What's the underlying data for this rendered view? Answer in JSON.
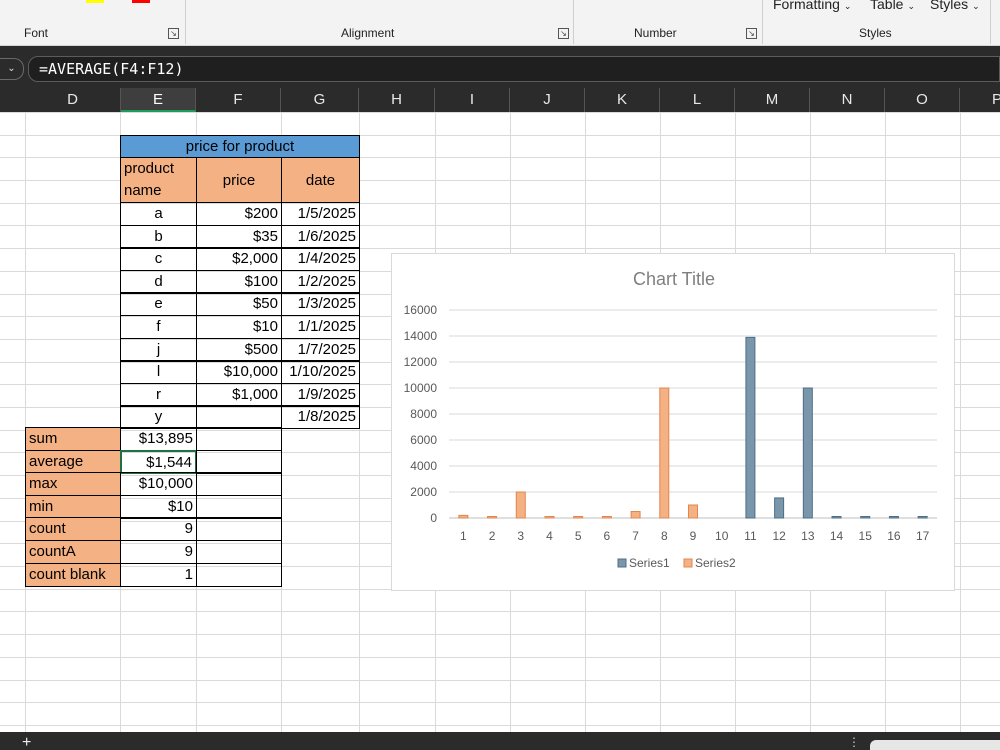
{
  "ribbon": {
    "groups": [
      "Font",
      "Alignment",
      "Number",
      "Styles"
    ],
    "buttons": [
      "Formatting",
      "Table",
      "Styles"
    ],
    "colors": {
      "highlight": "#ffff00",
      "font_color": "#ff0000"
    }
  },
  "formula_bar": {
    "formula": "=AVERAGE(F4:F12)"
  },
  "columns": [
    "D",
    "E",
    "F",
    "G",
    "H",
    "I",
    "J",
    "K",
    "L",
    "M",
    "N",
    "O",
    "P"
  ],
  "selected_column": "E",
  "product_table": {
    "title": "price for product",
    "headers": [
      "product name",
      "price",
      "date"
    ],
    "rows": [
      {
        "name": "a",
        "price": "$200",
        "date": "1/5/2025"
      },
      {
        "name": "b",
        "price": "$35",
        "date": "1/6/2025"
      },
      {
        "name": "c",
        "price": "$2,000",
        "date": "1/4/2025"
      },
      {
        "name": "d",
        "price": "$100",
        "date": "1/2/2025"
      },
      {
        "name": "e",
        "price": "$50",
        "date": "1/3/2025"
      },
      {
        "name": "f",
        "price": "$10",
        "date": "1/1/2025"
      },
      {
        "name": "j",
        "price": "$500",
        "date": "1/7/2025"
      },
      {
        "name": "l",
        "price": "$10,000",
        "date": "1/10/2025"
      },
      {
        "name": "r",
        "price": "$1,000",
        "date": "1/9/2025"
      },
      {
        "name": "y",
        "price": "",
        "date": "1/8/2025"
      }
    ]
  },
  "summary": [
    {
      "label": "sum",
      "value": "$13,895"
    },
    {
      "label": "average",
      "value": "$1,544"
    },
    {
      "label": "max",
      "value": "$10,000"
    },
    {
      "label": "min",
      "value": "$10"
    },
    {
      "label": "count",
      "value": "9"
    },
    {
      "label": "countA",
      "value": "9"
    },
    {
      "label": "count blank",
      "value": "1"
    }
  ],
  "chart_data": {
    "type": "bar",
    "title": "Chart Title",
    "categories": [
      "1",
      "2",
      "3",
      "4",
      "5",
      "6",
      "7",
      "8",
      "9",
      "10",
      "11",
      "12",
      "13",
      "14",
      "15",
      "16",
      "17"
    ],
    "series": [
      {
        "name": "Series1",
        "color": "#7996ab",
        "values": [
          null,
          null,
          null,
          null,
          null,
          null,
          null,
          null,
          null,
          null,
          13895,
          1544,
          10000,
          10,
          9,
          9,
          1
        ]
      },
      {
        "name": "Series2",
        "color": "#f4b183",
        "values": [
          200,
          35,
          2000,
          100,
          50,
          10,
          500,
          10000,
          1000,
          null,
          null,
          null,
          null,
          null,
          null,
          null,
          null
        ]
      }
    ],
    "ylim": [
      0,
      16000
    ],
    "yticks": [
      0,
      2000,
      4000,
      6000,
      8000,
      10000,
      12000,
      14000,
      16000
    ],
    "grid": true,
    "legend": "bottom"
  }
}
